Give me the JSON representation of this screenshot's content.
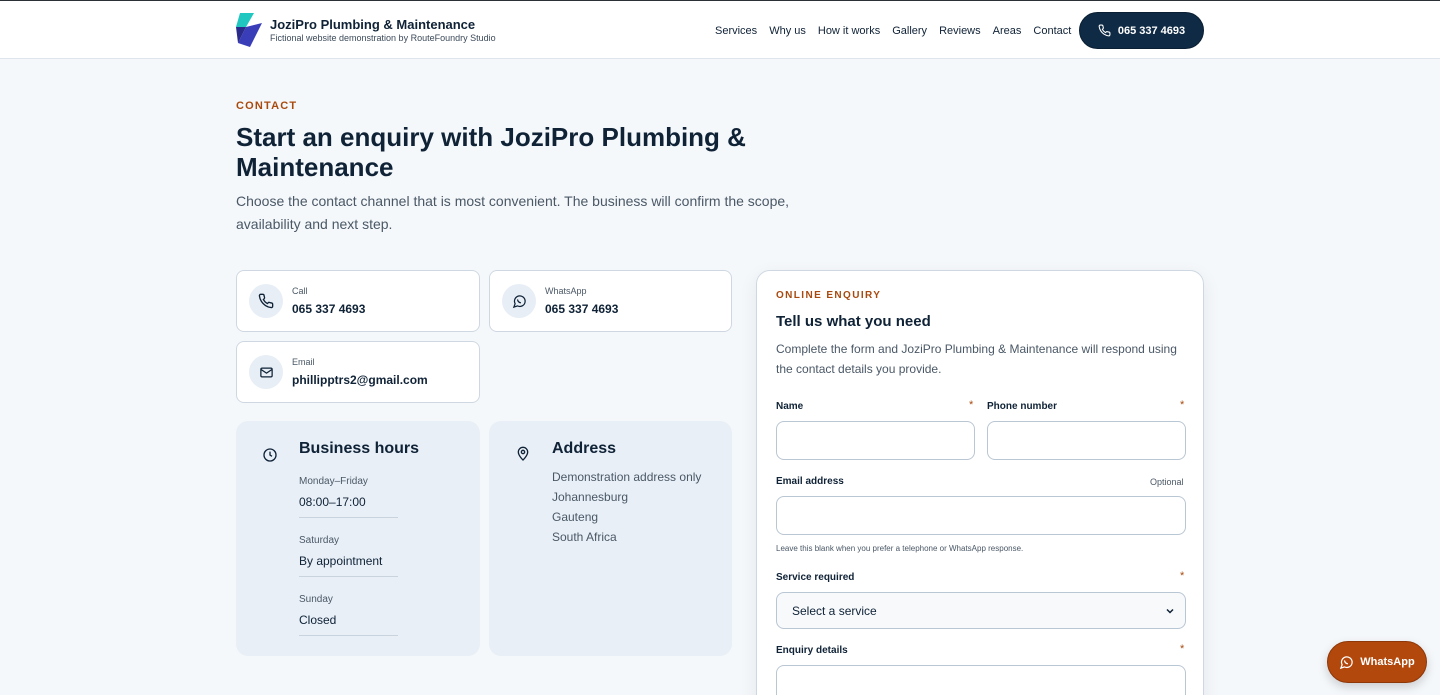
{
  "header": {
    "brand_name": "JoziPro Plumbing & Maintenance",
    "brand_tagline": "Fictional website demonstration by RouteFoundry Studio",
    "nav": [
      "Services",
      "Why us",
      "How it works",
      "Gallery",
      "Reviews",
      "Areas",
      "Contact"
    ],
    "call_button": "065 337 4693"
  },
  "intro": {
    "eyebrow": "CONTACT",
    "headline": "Start an enquiry with JoziPro Plumbing & Maintenance",
    "lede": "Choose the contact channel that is most convenient. The business will confirm the scope, availability and next step."
  },
  "contacts": {
    "call": {
      "label": "Call",
      "value": "065 337 4693"
    },
    "whatsapp": {
      "label": "WhatsApp",
      "value": "065 337 4693"
    },
    "email": {
      "label": "Email",
      "value": "phillipptrs2@gmail.com"
    }
  },
  "hours": {
    "title": "Business hours",
    "rows": [
      {
        "day": "Monday–Friday",
        "time": "08:00–17:00"
      },
      {
        "day": "Saturday",
        "time": "By appointment"
      },
      {
        "day": "Sunday",
        "time": "Closed"
      }
    ]
  },
  "address": {
    "title": "Address",
    "lines": [
      "Demonstration address only",
      "Johannesburg",
      "Gauteng",
      "South Africa"
    ]
  },
  "form": {
    "eyebrow": "ONLINE ENQUIRY",
    "title": "Tell us what you need",
    "description": "Complete the form and JoziPro Plumbing & Maintenance will respond using the contact details you provide.",
    "name_label": "Name",
    "phone_label": "Phone number",
    "email_label": "Email address",
    "optional_text": "Optional",
    "email_hint": "Leave this blank when you prefer a telephone or WhatsApp response.",
    "service_label": "Service required",
    "service_selected": "Select a service",
    "details_label": "Enquiry details",
    "required_mark": "*"
  },
  "whatsapp_fab": "WhatsApp",
  "colors": {
    "accent": "#a84a0e",
    "navy": "#0f2a44",
    "panel": "#e8eff7"
  }
}
